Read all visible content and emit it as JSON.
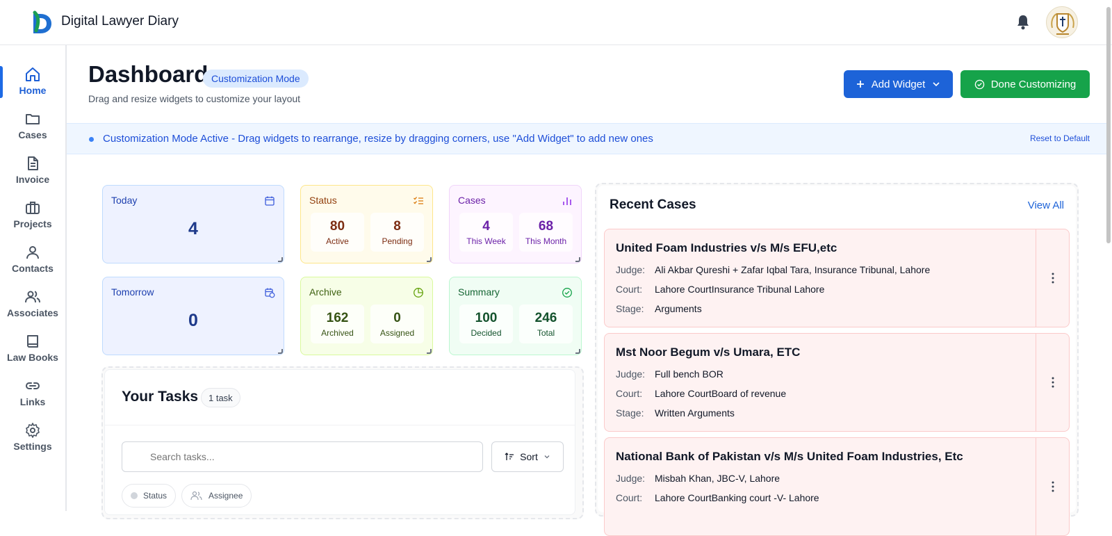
{
  "app": {
    "title": "Digital Lawyer Diary"
  },
  "sidebar": {
    "items": [
      {
        "label": "Home",
        "icon": "home-icon"
      },
      {
        "label": "Cases",
        "icon": "folder-icon"
      },
      {
        "label": "Invoice",
        "icon": "document-icon"
      },
      {
        "label": "Projects",
        "icon": "briefcase-icon"
      },
      {
        "label": "Contacts",
        "icon": "user-icon"
      },
      {
        "label": "Associates",
        "icon": "users-icon"
      },
      {
        "label": "Law Books",
        "icon": "book-icon"
      },
      {
        "label": "Links",
        "icon": "link-icon"
      },
      {
        "label": "Settings",
        "icon": "gear-icon"
      }
    ]
  },
  "header": {
    "title": "Dashboard",
    "badge": "Customization Mode",
    "subtitle": "Drag and resize widgets to customize your layout",
    "add_widget": "Add Widget",
    "done": "Done Customizing"
  },
  "banner": {
    "text": "Customization Mode Active - Drag widgets to rearrange, resize by dragging corners, use \"Add Widget\" to add new ones",
    "reset": "Reset to Default"
  },
  "cards": {
    "today": {
      "title": "Today",
      "value": "4"
    },
    "tomorrow": {
      "title": "Tomorrow",
      "value": "0"
    },
    "status": {
      "title": "Status",
      "a_value": "80",
      "a_label": "Active",
      "b_value": "8",
      "b_label": "Pending"
    },
    "cases": {
      "title": "Cases",
      "a_value": "4",
      "a_label": "This Week",
      "b_value": "68",
      "b_label": "This Month"
    },
    "archive": {
      "title": "Archive",
      "a_value": "162",
      "a_label": "Archived",
      "b_value": "0",
      "b_label": "Assigned"
    },
    "summary": {
      "title": "Summary",
      "a_value": "100",
      "a_label": "Decided",
      "b_value": "246",
      "b_label": "Total"
    }
  },
  "tasks": {
    "title": "Your Tasks",
    "count": "1 task",
    "search_placeholder": "Search tasks...",
    "sort": "Sort",
    "filters": {
      "status": "Status",
      "assignee": "Assignee"
    }
  },
  "recent_cases": {
    "title": "Recent Cases",
    "view_all": "View All",
    "labels": {
      "judge": "Judge:",
      "court": "Court:",
      "stage": "Stage:"
    },
    "items": [
      {
        "title": "United Foam Industries v/s M/s EFU,etc",
        "judge": "Ali Akbar Qureshi + Zafar Iqbal Tara, Insurance Tribunal, Lahore",
        "court": "Lahore CourtInsurance Tribunal Lahore",
        "stage": "Arguments"
      },
      {
        "title": "Mst Noor Begum v/s Umara, ETC",
        "judge": "Full bench BOR",
        "court": "Lahore CourtBoard of revenue",
        "stage": "Written Arguments"
      },
      {
        "title": "National Bank of Pakistan v/s M/s United Foam Industries, Etc",
        "judge": "Misbah Khan, JBC-V, Lahore",
        "court": "Lahore CourtBanking court -V- Lahore",
        "stage": ""
      }
    ]
  },
  "colors": {
    "primary": "#1d63d8",
    "success": "#16a34a",
    "case_bg": "#fef2f2"
  }
}
